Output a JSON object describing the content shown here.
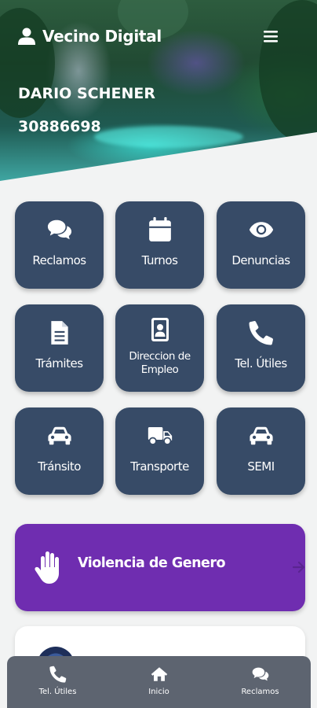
{
  "app": {
    "title": "Vecino Digital"
  },
  "user": {
    "name": "DARIO SCHENER",
    "id": "30886698"
  },
  "header_icons": {
    "user": "user-icon",
    "menu": "hamburger-menu-icon"
  },
  "tiles": [
    {
      "label": "Reclamos",
      "icon": "comments-icon"
    },
    {
      "label": "Turnos",
      "icon": "calendar-icon"
    },
    {
      "label": "Denuncias",
      "icon": "eye-icon"
    },
    {
      "label": "Trámites",
      "icon": "document-icon"
    },
    {
      "label": "Direccion de Empleo",
      "icon": "id-badge-icon"
    },
    {
      "label": "Tel. Útiles",
      "icon": "phone-icon"
    },
    {
      "label": "Tránsito",
      "icon": "car-icon"
    },
    {
      "label": "Transporte",
      "icon": "truck-icon"
    },
    {
      "label": "SEMI",
      "icon": "car-icon"
    }
  ],
  "banner": {
    "label": "Violencia de Genero",
    "icon": "hand-icon",
    "arrow": "arrow-right-icon"
  },
  "bottom_nav": [
    {
      "label": "Tel. Útiles",
      "icon": "phone-icon"
    },
    {
      "label": "Inicio",
      "icon": "home-icon"
    },
    {
      "label": "Reclamos",
      "icon": "comments-icon"
    }
  ],
  "colors": {
    "tile": "#374b67",
    "banner": "#6f2db0",
    "bottom_nav": "#5d6470",
    "background": "#f2f3f3"
  }
}
